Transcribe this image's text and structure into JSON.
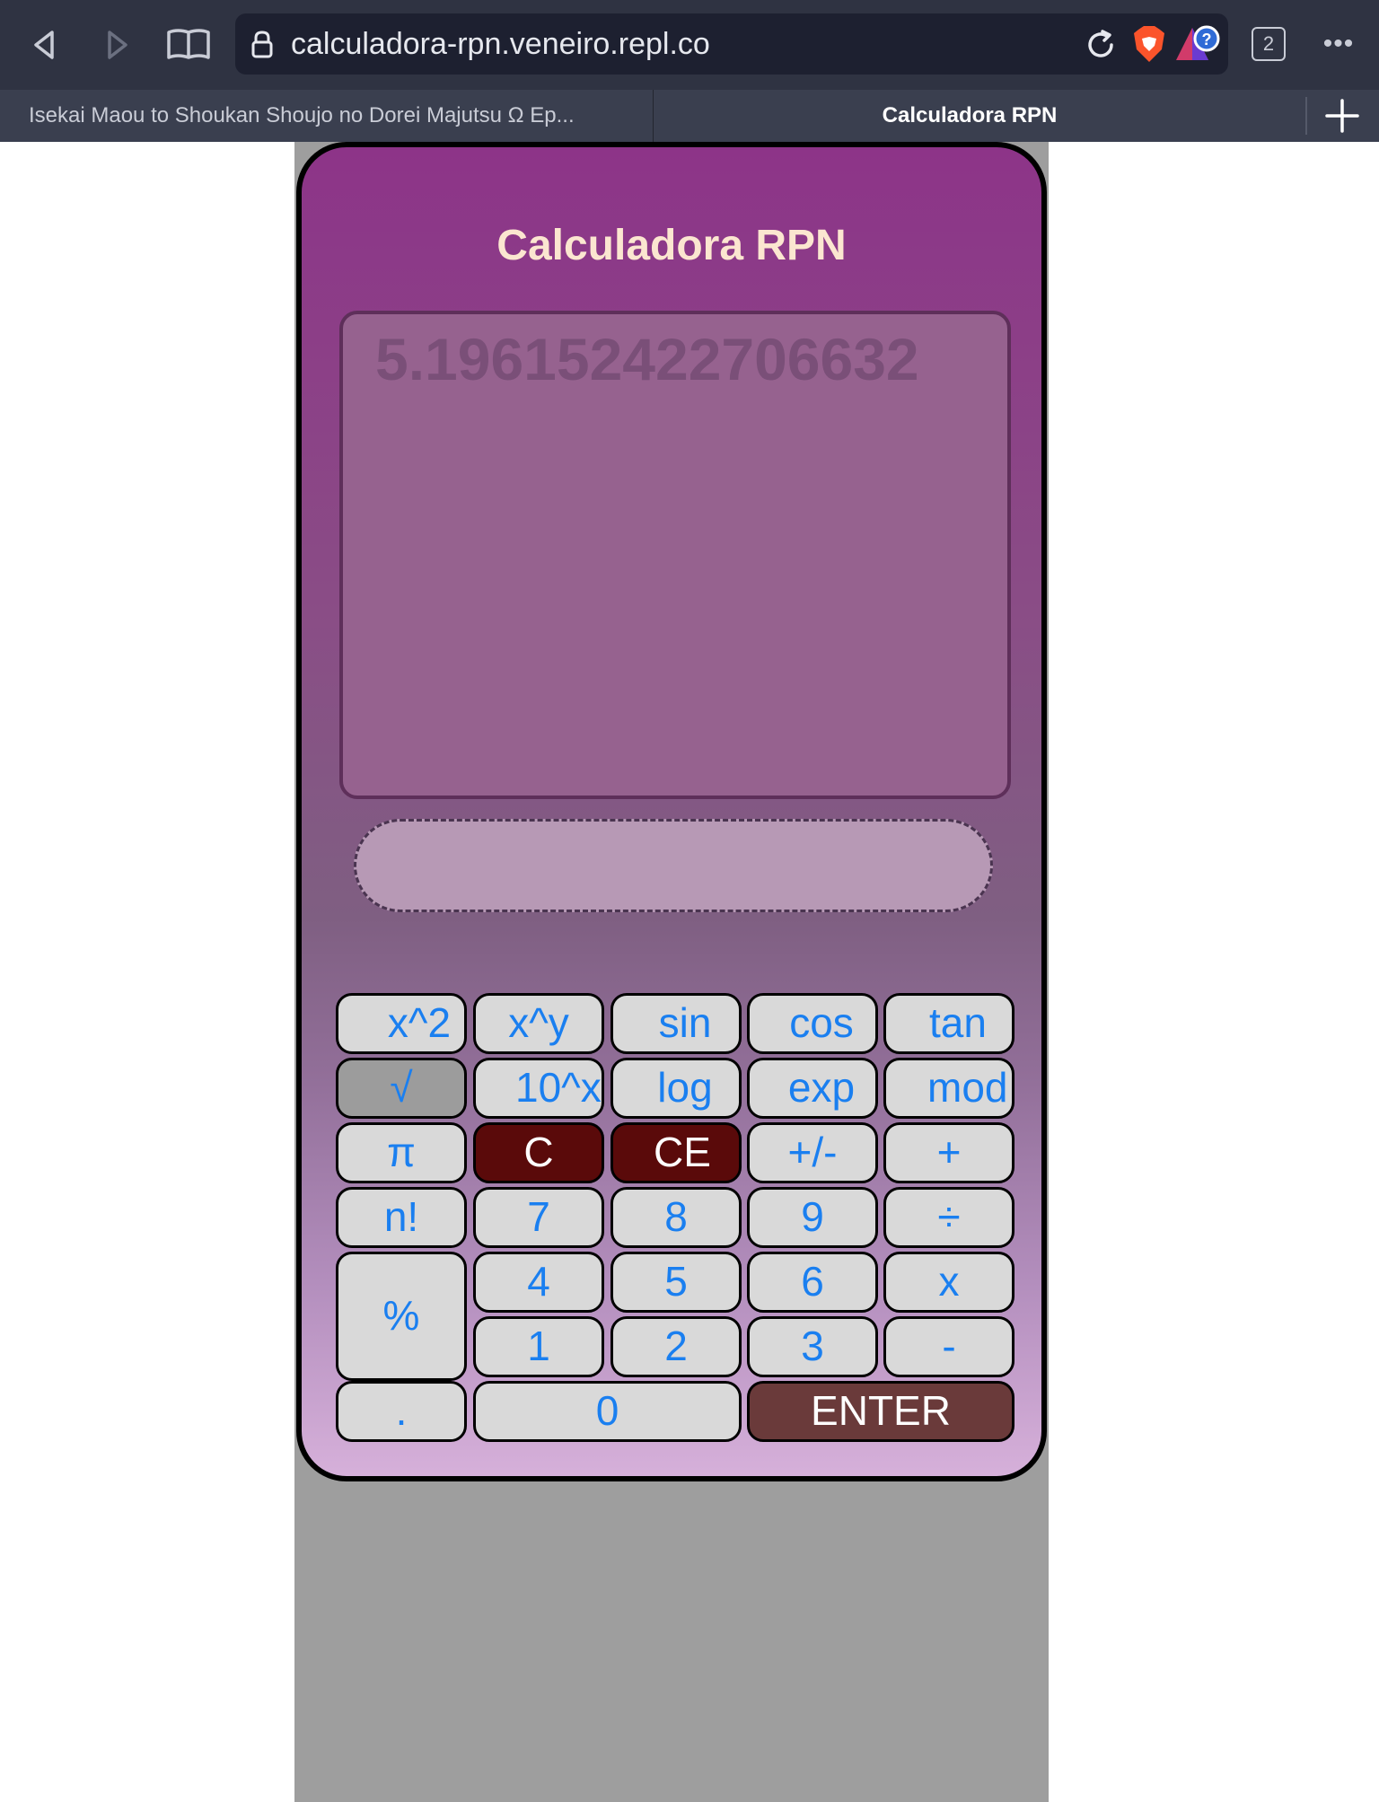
{
  "browser": {
    "url": "calculadora-rpn.veneiro.repl.co",
    "tab_count": "2",
    "more_label": "•••",
    "tabs": [
      {
        "title": "Isekai Maou to Shoukan Shoujo no Dorei Majutsu Ω Ep..."
      },
      {
        "title": "Calculadora RPN"
      }
    ],
    "icons": [
      "back-icon",
      "forward-icon",
      "reader-icon",
      "lock-icon",
      "reload-icon",
      "brave-shield-icon",
      "rewards-icon",
      "close-icon",
      "plus-icon"
    ]
  },
  "calculator": {
    "title": "Calculadora RPN",
    "display_value": "5.196152422706632",
    "entry_value": "",
    "colors": {
      "gradient_top": "#8d3488",
      "gradient_bottom": "#d6b0da",
      "key_bg": "#d9d9d9",
      "key_text": "#1a7ff0",
      "clear_key_bg": "#5a0a0a",
      "enter_key_bg": "#6a3a3a",
      "page_bg": "#9e9e9e"
    },
    "keys": {
      "square": "x^2",
      "power": "x^y",
      "sin": "sin",
      "cos": "cos",
      "tan": "tan",
      "sqrt": "√",
      "pow10": "10^x",
      "log": "log",
      "exp": "exp",
      "mod": "mod",
      "pi": "π",
      "clear": "C",
      "clear_entry": "CE",
      "negate": "+/-",
      "add": "+",
      "factorial": "n!",
      "d7": "7",
      "d8": "8",
      "d9": "9",
      "divide": "÷",
      "percent": "%",
      "d4": "4",
      "d5": "5",
      "d6": "6",
      "multiply": "x",
      "d1": "1",
      "d2": "2",
      "d3": "3",
      "subtract": "-",
      "decimal": ".",
      "d0": "0",
      "enter": "ENTER"
    }
  }
}
